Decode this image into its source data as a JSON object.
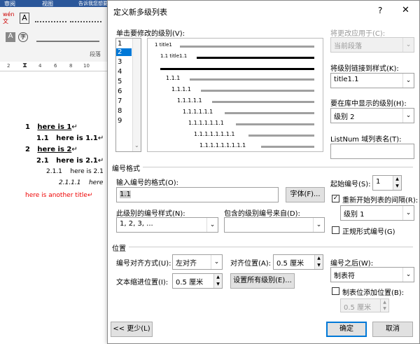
{
  "background": {
    "ribbon": {
      "tabs": [
        "审阅",
        "视图"
      ],
      "tell_me": "告诉我您想要做什么",
      "groups": {
        "font_char": "A",
        "paragraph_label": "段落"
      },
      "ruler_ticks": [
        "2",
        "2",
        "4",
        "6",
        "8",
        "10"
      ]
    },
    "doc_lines": [
      {
        "num": "1",
        "text": "here is 1"
      },
      {
        "num": "1.1",
        "text": "here is 1.1"
      },
      {
        "num": "2",
        "text": "here is 2"
      },
      {
        "num": "2.1",
        "text": "here is 2.1"
      },
      {
        "num": "2.1.1",
        "text": "here is 2.1"
      },
      {
        "num": "2.1.1.1",
        "text": "here"
      },
      {
        "num": "",
        "text": "here is another title"
      }
    ],
    "para_mark": "↵"
  },
  "dialog": {
    "title": "定义新多级列表",
    "help": "?",
    "close": "✕",
    "click_level_label": "单击要修改的级别(V):",
    "levels": [
      "1",
      "2",
      "3",
      "4",
      "5",
      "6",
      "7",
      "8",
      "9"
    ],
    "selected_level": "2",
    "apply_to_label": "将更改应用于(C):",
    "apply_to_value": "当前段落",
    "link_style_label": "将级别链接到样式(K):",
    "link_style_value": "title1.1",
    "gallery_level_label": "要在库中显示的级别(H):",
    "gallery_level_value": "级别 2",
    "listnum_label": "ListNum 域列表名(T):",
    "listnum_value": "",
    "preview": [
      {
        "num": "1",
        "text": "title1"
      },
      {
        "num": "1.1",
        "text": "title1.1"
      },
      {
        "num": "",
        "text": ""
      },
      {
        "num": "1.1.1",
        "text": ""
      },
      {
        "num": "1.1.1.1",
        "text": ""
      },
      {
        "num": "1.1.1.1.1",
        "text": ""
      },
      {
        "num": "1.1.1.1.1.1",
        "text": ""
      },
      {
        "num": "1.1.1.1.1.1.1",
        "text": ""
      },
      {
        "num": "1.1.1.1.1.1.1.1",
        "text": ""
      },
      {
        "num": "1.1.1.1.1.1.1.1.1",
        "text": ""
      }
    ],
    "number_format_section": "编号格式",
    "enter_format_label": "输入编号的格式(O):",
    "format_value": "1.1",
    "font_button": "字体(F)...",
    "number_style_label": "此级别的编号样式(N):",
    "number_style_value": "1, 2, 3, ...",
    "include_level_label": "包含的级别编号来自(D):",
    "include_level_value": "",
    "start_at_label": "起始编号(S):",
    "start_at_value": "1",
    "restart_label": "重新开始列表的间隔(R):",
    "restart_value": "级别 1",
    "legal_label": "正规形式编号(G)",
    "position_section": "位置",
    "alignment_label": "编号对齐方式(U):",
    "alignment_value": "左对齐",
    "align_at_label": "对齐位置(A):",
    "align_at_value": "0.5 厘米",
    "indent_label": "文本缩进位置(I):",
    "indent_value": "0.5 厘米",
    "set_all_button": "设置所有级别(E)...",
    "follow_label": "编号之后(W):",
    "follow_value": "制表符",
    "tab_stop_label": "制表位添加位置(B):",
    "tab_stop_value": "0.5 厘米",
    "less_button": "<< 更少(L)",
    "ok_button": "确定",
    "cancel_button": "取消",
    "check_mark": "✓",
    "arrow_down": "⌄",
    "spin_up": "▲",
    "spin_down": "▼"
  }
}
